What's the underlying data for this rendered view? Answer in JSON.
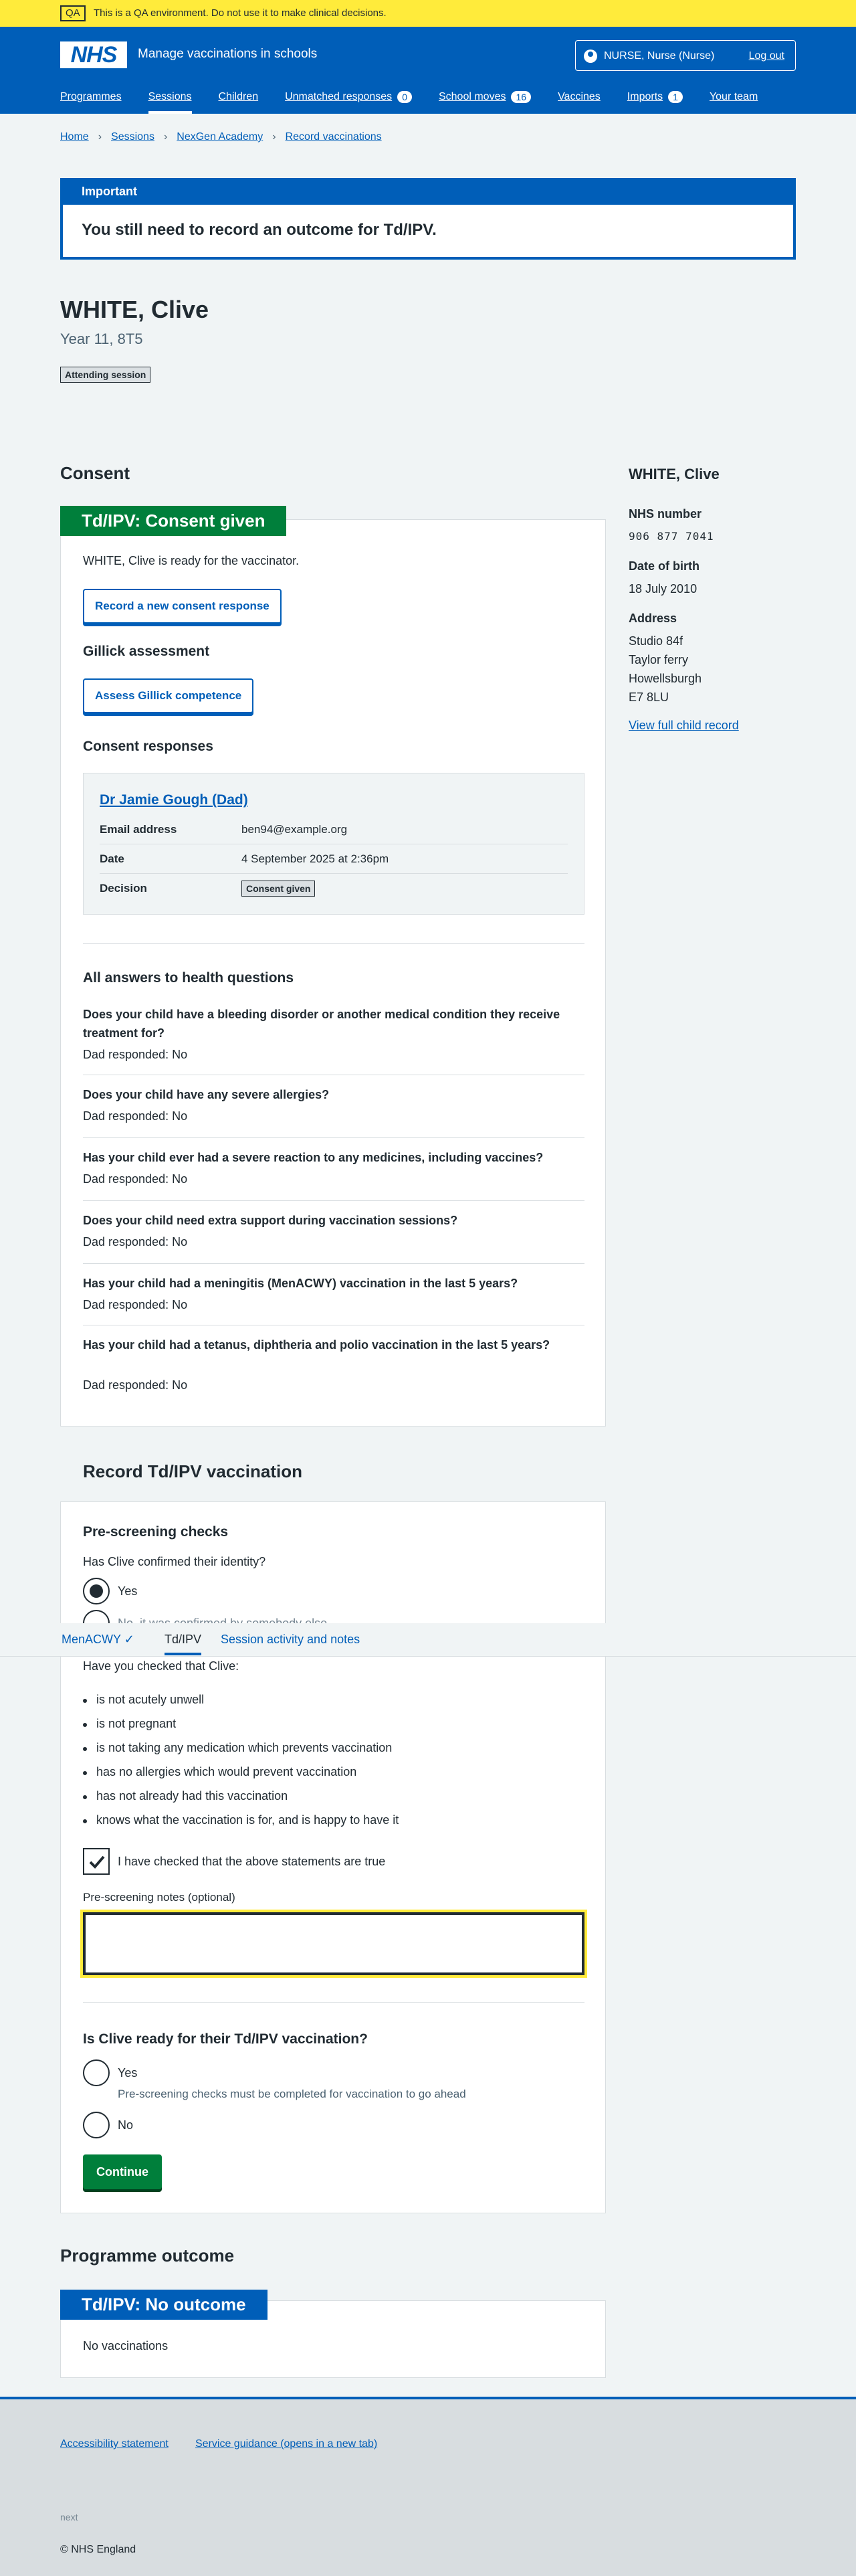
{
  "qa": {
    "tag": "QA",
    "text": "This is a QA environment. Do not use it to make clinical decisions."
  },
  "header": {
    "logo": "NHS",
    "service": "Manage vaccinations in schools",
    "account": "NURSE, Nurse (Nurse)",
    "logout": "Log out",
    "nav": [
      {
        "label": "Programmes"
      },
      {
        "label": "Sessions"
      },
      {
        "label": "Children"
      },
      {
        "label": "Unmatched responses",
        "count": "0"
      },
      {
        "label": "School moves",
        "count": "16"
      },
      {
        "label": "Vaccines"
      },
      {
        "label": "Imports",
        "count": "1"
      },
      {
        "label": "Your team"
      }
    ]
  },
  "breadcrumb": [
    "Home",
    "Sessions",
    "NexGen Academy",
    "Record vaccinations"
  ],
  "important": {
    "heading": "Important",
    "body": "You still need to record an outcome for Td/IPV."
  },
  "patient": {
    "name": "WHITE, Clive",
    "year": "Year 11, 8T5",
    "status": "Attending session"
  },
  "consent": {
    "heading": "Consent",
    "banner": "Td/IPV: Consent given",
    "ready_text": "WHITE, Clive is ready for the vaccinator.",
    "record_button": "Record a new consent response",
    "gillick_heading": "Gillick assessment",
    "gillick_button": "Assess Gillick competence",
    "responses_heading": "Consent responses",
    "response": {
      "name": "Dr Jamie Gough (Dad)",
      "email_key": "Email address",
      "email": "ben94@example.org",
      "date_key": "Date",
      "date": "4 September 2025 at 2:36pm",
      "decision_key": "Decision",
      "decision": "Consent given"
    },
    "health_heading": "All answers to health questions",
    "questions": [
      {
        "q": "Does your child have a bleeding disorder or another medical condition they receive treatment for?",
        "a": "Dad responded: No"
      },
      {
        "q": "Does your child have any severe allergies?",
        "a": "Dad responded: No"
      },
      {
        "q": "Has your child ever had a severe reaction to any medicines, including vaccines?",
        "a": "Dad responded: No"
      },
      {
        "q": "Does your child need extra support during vaccination sessions?",
        "a": "Dad responded: No"
      },
      {
        "q": "Has your child had a meningitis (MenACWY) vaccination in the last 5 years?",
        "a": "Dad responded: No"
      },
      {
        "q": "Has your child had a tetanus, diphtheria and polio vaccination in the last 5 years?",
        "a": "Dad responded: No"
      }
    ]
  },
  "sidebar": {
    "name": "WHITE, Clive",
    "nhs_key": "NHS number",
    "nhs": "906 877 7041",
    "dob_key": "Date of birth",
    "dob": "18 July 2010",
    "address_key": "Address",
    "address": [
      "Studio 84f",
      "Taylor ferry",
      "Howellsburgh",
      "E7 8LU"
    ],
    "link": "View full child record"
  },
  "record": {
    "heading": "Record Td/IPV vaccination",
    "prescreen_heading": "Pre-screening checks",
    "identity_q": "Has Clive confirmed their identity?",
    "identity_yes": "Yes",
    "identity_no_partial": "No, it was confirmed by somebody else",
    "checked_intro": "Have you checked that Clive:",
    "checks": [
      "is not acutely unwell",
      "is not pregnant",
      "is not taking any medication which prevents vaccination",
      "has no allergies which would prevent vaccination",
      "has not already had this vaccination",
      "knows what the vaccination is for, and is happy to have it"
    ],
    "checkbox_label": "I have checked that the above statements are true",
    "notes_label": "Pre-screening notes (optional)",
    "ready_q": "Is Clive ready for their Td/IPV vaccination?",
    "yes": "Yes",
    "yes_hint": "Pre-screening checks must be completed for vaccination to go ahead",
    "no": "No",
    "continue": "Continue"
  },
  "tabs": [
    {
      "label": "MenACWY"
    },
    {
      "label": "Td/IPV"
    },
    {
      "label": "Session activity and notes"
    }
  ],
  "outcome": {
    "heading": "Programme outcome",
    "banner": "Td/IPV: No outcome",
    "text": "No vaccinations"
  },
  "footer": {
    "links": [
      "Accessibility statement",
      "Service guidance (opens in a new tab)"
    ],
    "small": "next",
    "copy": "© NHS England"
  },
  "colors": {
    "nhs_blue": "#005eb8",
    "green": "#007f3b",
    "yellow": "#ffeb3b"
  }
}
